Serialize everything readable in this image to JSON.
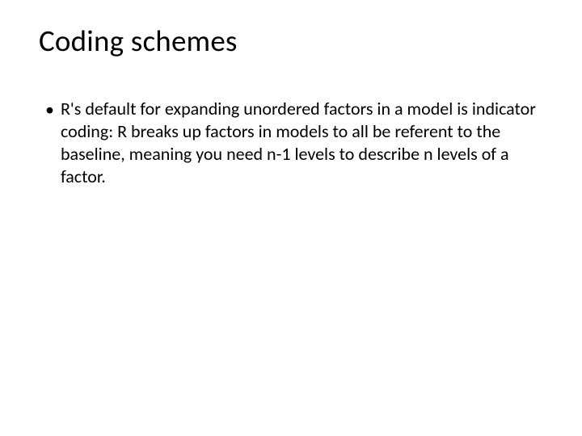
{
  "slide": {
    "title": "Coding schemes",
    "bullets": [
      {
        "marker": "•",
        "text": "R's default for expanding unordered factors in a model is indicator coding: R breaks up factors in models to all be referent to the baseline, meaning you need n-1 levels to describe n levels of a factor."
      }
    ]
  }
}
